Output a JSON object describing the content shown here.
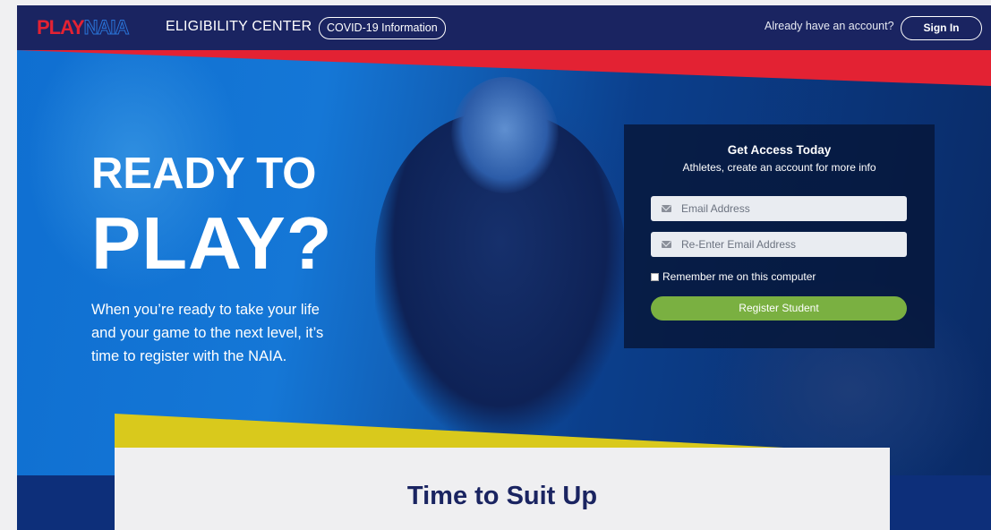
{
  "header": {
    "logo_play": "PLAY",
    "logo_naia": "NAIA",
    "title": "ELIGIBILITY CENTER",
    "covid_label": "COVID-19 Information",
    "already_text": "Already have an account?",
    "signin_label": "Sign In"
  },
  "hero": {
    "headline_1": "READY TO",
    "headline_2": "PLAY?",
    "copy": "When you’re ready to take your life and your game to the next level, it’s time to register with the NAIA."
  },
  "form": {
    "title": "Get Access Today",
    "subtitle": "Athletes, create an account for more info",
    "email_placeholder": "Email Address",
    "reemail_placeholder": "Re-Enter Email Address",
    "remember_label": "Remember me on this computer",
    "remember_checked": false,
    "register_label": "Register Student"
  },
  "section": {
    "title": "Time to Suit Up"
  },
  "icons": {
    "email": "envelope-icon",
    "checkbox": "checkbox-icon"
  },
  "colors": {
    "navy": "#1a2461",
    "red": "#e32233",
    "green": "#7ab041",
    "yellow": "#d9c91c",
    "blue": "#0d2f7a"
  }
}
